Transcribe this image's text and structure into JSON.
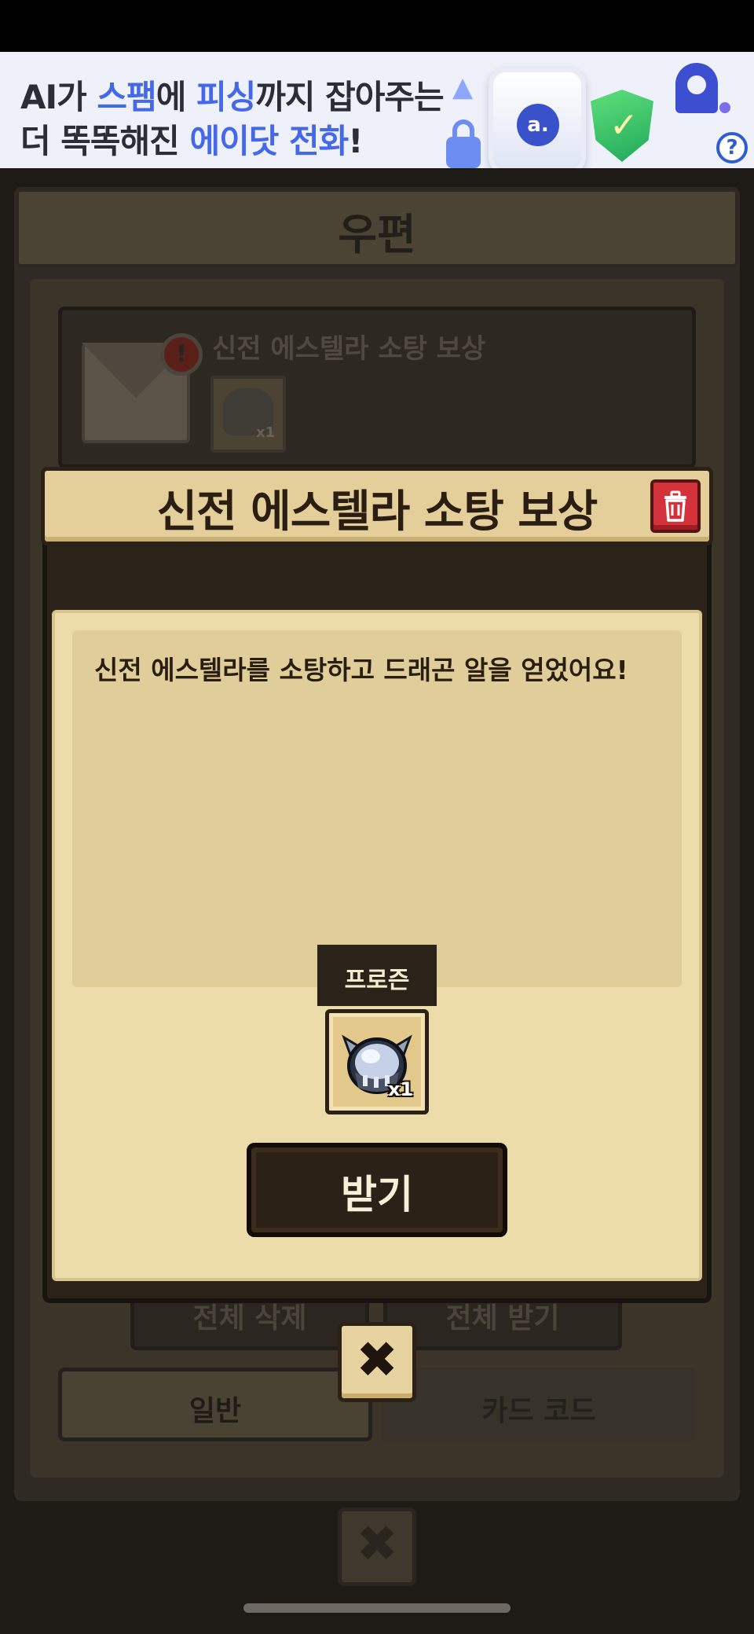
{
  "ad": {
    "line1_a": "AI가 ",
    "line1_b": "스팸",
    "line1_c": "에 ",
    "line1_d": "피싱",
    "line1_e": "까지 잡아주는",
    "line2_a": "더 똑똑해진 ",
    "line2_b": "에이닷 전화",
    "line2_c": "!",
    "help_glyph": "?",
    "accent_color": "#4468e8"
  },
  "mail": {
    "title": "우편",
    "item": {
      "title": "신전 에스텔라 소탕 보상",
      "alert_glyph": "!",
      "reward_qty": "x1"
    },
    "delete_all_label": "전체 삭제",
    "receive_all_label": "전체 받기",
    "tabs": [
      "일반",
      "카드 코드"
    ],
    "close_glyph": "✖"
  },
  "modal": {
    "title": "신전 에스텔라 소탕 보상",
    "message": "신전 에스텔라를 소탕하고 드래곤 알을 얻었어요!",
    "reward": {
      "name": "프로즌",
      "qty": "x1",
      "icon": "frozen-dragon-egg-icon"
    },
    "receive_label": "받기",
    "close_glyph": "✖",
    "delete_icon": "trash-icon",
    "delete_color": "#d3323a"
  }
}
